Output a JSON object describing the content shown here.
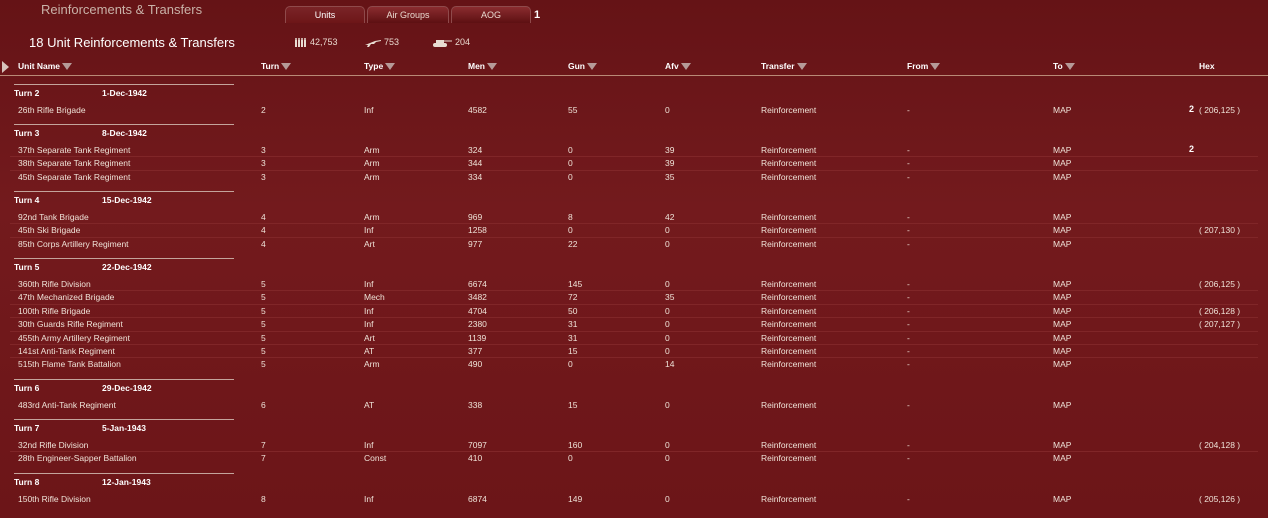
{
  "window_title": "Reinforcements & Transfers",
  "tabs": [
    {
      "label": "Units",
      "active": true
    },
    {
      "label": "Air Groups",
      "active": false
    },
    {
      "label": "AOG",
      "active": false
    }
  ],
  "tab_count": "1",
  "header": {
    "title": "18 Unit Reinforcements & Transfers",
    "men_total": "42,753",
    "guns_total": "753",
    "afv_total": "204"
  },
  "columns": [
    "Unit Name",
    "Turn",
    "Type",
    "Men",
    "Gun",
    "Afv",
    "Transfer",
    "From",
    "To",
    "Hex"
  ],
  "groups": [
    {
      "turn": "Turn 2",
      "date": "1-Dec-1942",
      "rows": [
        {
          "name": "26th Rifle Brigade",
          "turn": "2",
          "type": "Inf",
          "men": "4582",
          "gun": "55",
          "afv": "0",
          "transfer": "Reinforcement",
          "from": "-",
          "to": "MAP",
          "hex": "( 206,125 )",
          "marker": "2"
        }
      ]
    },
    {
      "turn": "Turn 3",
      "date": "8-Dec-1942",
      "rows": [
        {
          "name": "37th Separate Tank Regiment",
          "turn": "3",
          "type": "Arm",
          "men": "324",
          "gun": "0",
          "afv": "39",
          "transfer": "Reinforcement",
          "from": "-",
          "to": "MAP",
          "hex": "",
          "marker": "2"
        },
        {
          "name": "38th Separate Tank Regiment",
          "turn": "3",
          "type": "Arm",
          "men": "344",
          "gun": "0",
          "afv": "39",
          "transfer": "Reinforcement",
          "from": "-",
          "to": "MAP",
          "hex": "",
          "marker": ""
        },
        {
          "name": "45th Separate Tank Regiment",
          "turn": "3",
          "type": "Arm",
          "men": "334",
          "gun": "0",
          "afv": "35",
          "transfer": "Reinforcement",
          "from": "-",
          "to": "MAP",
          "hex": "",
          "marker": ""
        }
      ]
    },
    {
      "turn": "Turn 4",
      "date": "15-Dec-1942",
      "rows": [
        {
          "name": "92nd Tank Brigade",
          "turn": "4",
          "type": "Arm",
          "men": "969",
          "gun": "8",
          "afv": "42",
          "transfer": "Reinforcement",
          "from": "-",
          "to": "MAP",
          "hex": "",
          "marker": ""
        },
        {
          "name": "45th Ski Brigade",
          "turn": "4",
          "type": "Inf",
          "men": "1258",
          "gun": "0",
          "afv": "0",
          "transfer": "Reinforcement",
          "from": "-",
          "to": "MAP",
          "hex": "( 207,130 )",
          "marker": ""
        },
        {
          "name": "85th Corps Artillery Regiment",
          "turn": "4",
          "type": "Art",
          "men": "977",
          "gun": "22",
          "afv": "0",
          "transfer": "Reinforcement",
          "from": "-",
          "to": "MAP",
          "hex": "",
          "marker": ""
        }
      ]
    },
    {
      "turn": "Turn 5",
      "date": "22-Dec-1942",
      "rows": [
        {
          "name": "360th Rifle Division",
          "turn": "5",
          "type": "Inf",
          "men": "6674",
          "gun": "145",
          "afv": "0",
          "transfer": "Reinforcement",
          "from": "-",
          "to": "MAP",
          "hex": "( 206,125 )",
          "marker": ""
        },
        {
          "name": "47th Mechanized Brigade",
          "turn": "5",
          "type": "Mech",
          "men": "3482",
          "gun": "72",
          "afv": "35",
          "transfer": "Reinforcement",
          "from": "-",
          "to": "MAP",
          "hex": "",
          "marker": ""
        },
        {
          "name": "100th Rifle Brigade",
          "turn": "5",
          "type": "Inf",
          "men": "4704",
          "gun": "50",
          "afv": "0",
          "transfer": "Reinforcement",
          "from": "-",
          "to": "MAP",
          "hex": "( 206,128 )",
          "marker": ""
        },
        {
          "name": "30th Guards Rifle Regiment",
          "turn": "5",
          "type": "Inf",
          "men": "2380",
          "gun": "31",
          "afv": "0",
          "transfer": "Reinforcement",
          "from": "-",
          "to": "MAP",
          "hex": "( 207,127 )",
          "marker": ""
        },
        {
          "name": "455th Army Artillery Regiment",
          "turn": "5",
          "type": "Art",
          "men": "1139",
          "gun": "31",
          "afv": "0",
          "transfer": "Reinforcement",
          "from": "-",
          "to": "MAP",
          "hex": "",
          "marker": ""
        },
        {
          "name": "141st Anti-Tank Regiment",
          "turn": "5",
          "type": "AT",
          "men": "377",
          "gun": "15",
          "afv": "0",
          "transfer": "Reinforcement",
          "from": "-",
          "to": "MAP",
          "hex": "",
          "marker": ""
        },
        {
          "name": "515th Flame Tank Battalion",
          "turn": "5",
          "type": "Arm",
          "men": "490",
          "gun": "0",
          "afv": "14",
          "transfer": "Reinforcement",
          "from": "-",
          "to": "MAP",
          "hex": "",
          "marker": ""
        }
      ]
    },
    {
      "turn": "Turn 6",
      "date": "29-Dec-1942",
      "rows": [
        {
          "name": "483rd Anti-Tank Regiment",
          "turn": "6",
          "type": "AT",
          "men": "338",
          "gun": "15",
          "afv": "0",
          "transfer": "Reinforcement",
          "from": "-",
          "to": "MAP",
          "hex": "",
          "marker": ""
        }
      ]
    },
    {
      "turn": "Turn 7",
      "date": "5-Jan-1943",
      "rows": [
        {
          "name": "32nd Rifle Division",
          "turn": "7",
          "type": "Inf",
          "men": "7097",
          "gun": "160",
          "afv": "0",
          "transfer": "Reinforcement",
          "from": "-",
          "to": "MAP",
          "hex": "( 204,128 )",
          "marker": ""
        },
        {
          "name": "28th Engineer-Sapper Battalion",
          "turn": "7",
          "type": "Const",
          "men": "410",
          "gun": "0",
          "afv": "0",
          "transfer": "Reinforcement",
          "from": "-",
          "to": "MAP",
          "hex": "",
          "marker": ""
        }
      ]
    },
    {
      "turn": "Turn 8",
      "date": "12-Jan-1943",
      "rows": [
        {
          "name": "150th Rifle Division",
          "turn": "8",
          "type": "Inf",
          "men": "6874",
          "gun": "149",
          "afv": "0",
          "transfer": "Reinforcement",
          "from": "-",
          "to": "MAP",
          "hex": "( 205,126 )",
          "marker": ""
        }
      ]
    }
  ]
}
